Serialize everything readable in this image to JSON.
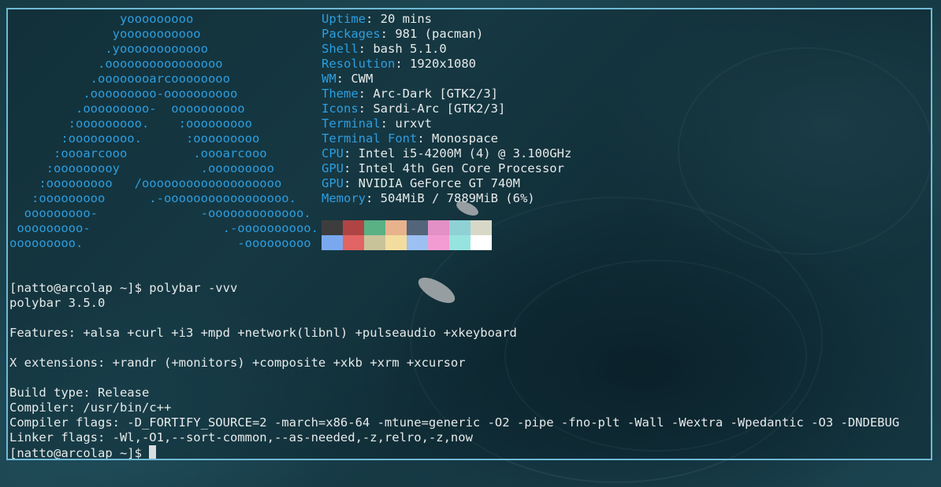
{
  "logo": {
    "lines": [
      "               yooooooooo",
      "              yooooooooooo",
      "             .yoooooooooooo",
      "            .oooooooooooooooo",
      "           .oooooooarcoooooooo",
      "          .ooooooooo-oooooooooo",
      "         .ooooooooo-  oooooooooo",
      "        :ooooooooo.    :ooooooooo",
      "       :ooooooooo.      :ooooooooo",
      "      :oooarcooo         .oooarcooo",
      "     :ooooooooy           .ooooooooo",
      "    :ooooooooo   /ooooooooooooooooooo",
      "   :ooooooooo      .-ooooooooooooooooo.",
      "  ooooooooo-              -ooooooooooooo.",
      " ooooooooo-                  .-oooooooooo.",
      "ooooooooo.                     -ooooooooo"
    ]
  },
  "info": [
    {
      "key": "Uptime",
      "sep": ": ",
      "value": "20 mins"
    },
    {
      "key": "Packages",
      "sep": ": ",
      "value": "981 (pacman)"
    },
    {
      "key": "Shell",
      "sep": ": ",
      "value": "bash 5.1.0"
    },
    {
      "key": "Resolution",
      "sep": ": ",
      "value": "1920x1080"
    },
    {
      "key": "WM",
      "sep": ": ",
      "value": "CWM"
    },
    {
      "key": "Theme",
      "sep": ": ",
      "value": "Arc-Dark [GTK2/3]"
    },
    {
      "key": "Icons",
      "sep": ": ",
      "value": "Sardi-Arc [GTK2/3]"
    },
    {
      "key": "Terminal",
      "sep": ": ",
      "value": "urxvt"
    },
    {
      "key": "Terminal Font",
      "sep": ": ",
      "value": "Monospace"
    },
    {
      "key": "CPU",
      "sep": ": ",
      "value": "Intel i5-4200M (4) @ 3.100GHz"
    },
    {
      "key": "GPU",
      "sep": ": ",
      "value": "Intel 4th Gen Core Processor"
    },
    {
      "key": "GPU",
      "sep": ": ",
      "value": "NVIDIA GeForce GT 740M"
    },
    {
      "key": "Memory",
      "sep": ": ",
      "value": "504MiB / 7889MiB (6%)"
    }
  ],
  "palette": {
    "row1": [
      "#3d3d3d",
      "#b04444",
      "#59b184",
      "#e8b28c",
      "#53657a",
      "#e290c6",
      "#8fd2d6",
      "#d8d8c8"
    ],
    "row2": [
      "#7aa8f0",
      "#e36464",
      "#c9c39a",
      "#f3dd9e",
      "#9cc0f2",
      "#f29bd3",
      "#96e4df",
      "#ffffff"
    ]
  },
  "shell": {
    "lines": [
      "[natto@arcolap ~]$ polybar -vvv",
      "polybar 3.5.0",
      "",
      "Features: +alsa +curl +i3 +mpd +network(libnl) +pulseaudio +xkeyboard",
      "",
      "X extensions: +randr (+monitors) +composite +xkb +xrm +xcursor",
      "",
      "Build type: Release",
      "Compiler: /usr/bin/c++",
      "Compiler flags: -D_FORTIFY_SOURCE=2 -march=x86-64 -mtune=generic -O2 -pipe -fno-plt -Wall -Wextra -Wpedantic -O3 -DNDEBUG",
      "Linker flags: -Wl,-O1,--sort-common,--as-needed,-z,relro,-z,now"
    ],
    "prompt": "[natto@arcolap ~]$ "
  },
  "colors": {
    "accent": "#2d9ee0",
    "border": "#6fb9d6",
    "text": "#e6eaea"
  }
}
